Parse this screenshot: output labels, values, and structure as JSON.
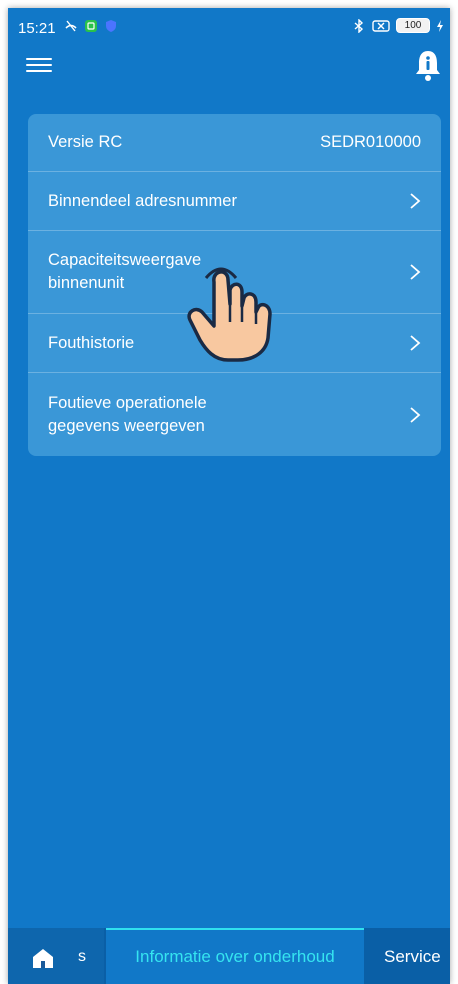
{
  "status_bar": {
    "time": "15:21",
    "battery": "100"
  },
  "topbar": {
    "menu_icon": "hamburger-menu-icon",
    "bell_icon": "bell-info-icon"
  },
  "card": {
    "rows": [
      {
        "label": "Versie RC",
        "value": "SEDR010000"
      },
      {
        "label": "Binnendeel adresnummer"
      },
      {
        "label_line1": "Capaciteitsweergave",
        "label_line2": "binnenunit"
      },
      {
        "label": "Fouthistorie"
      },
      {
        "label_line1": "Foutieve operationele",
        "label_line2": "gegevens weergeven"
      }
    ]
  },
  "tabs": {
    "partial_label": "s",
    "active": "Informatie over onderhoud",
    "service": "Service"
  },
  "colors": {
    "background": "#1178c8",
    "card": "#3a97d7",
    "active_tab": "#35e4f0",
    "tabbar": "#0a5fa6"
  }
}
